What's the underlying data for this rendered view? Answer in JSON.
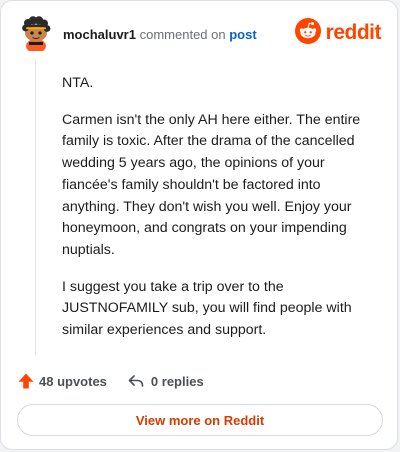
{
  "header": {
    "username": "mochaluvr1",
    "action_text": "commented on",
    "post_link": "post",
    "logo_text": "reddit"
  },
  "comment": {
    "paragraphs": [
      "NTA.",
      "Carmen isn't the only AH here either. The entire family is toxic. After the drama of the cancelled wedding 5 years ago, the opinions of your fiancée's family shouldn't be factored into anything. They don't wish you well. Enjoy your honeymoon, and congrats on your impending nuptials.",
      "I suggest you take a trip over to the JUSTNOFAMILY sub, you will find people with similar experiences and support."
    ]
  },
  "actions": {
    "upvotes": "48 upvotes",
    "replies": "0 replies"
  },
  "footer": {
    "view_more": "View more on Reddit"
  },
  "colors": {
    "brand": "#ff4500",
    "upvote": "#ff4500",
    "link": "#0b63c9",
    "view_more_text": "#d93a00"
  },
  "icons": {
    "avatar": "snoo-avatar-icon",
    "logo": "reddit-snoo-icon",
    "upvote": "upvote-arrow-icon",
    "reply": "reply-arrow-icon"
  }
}
